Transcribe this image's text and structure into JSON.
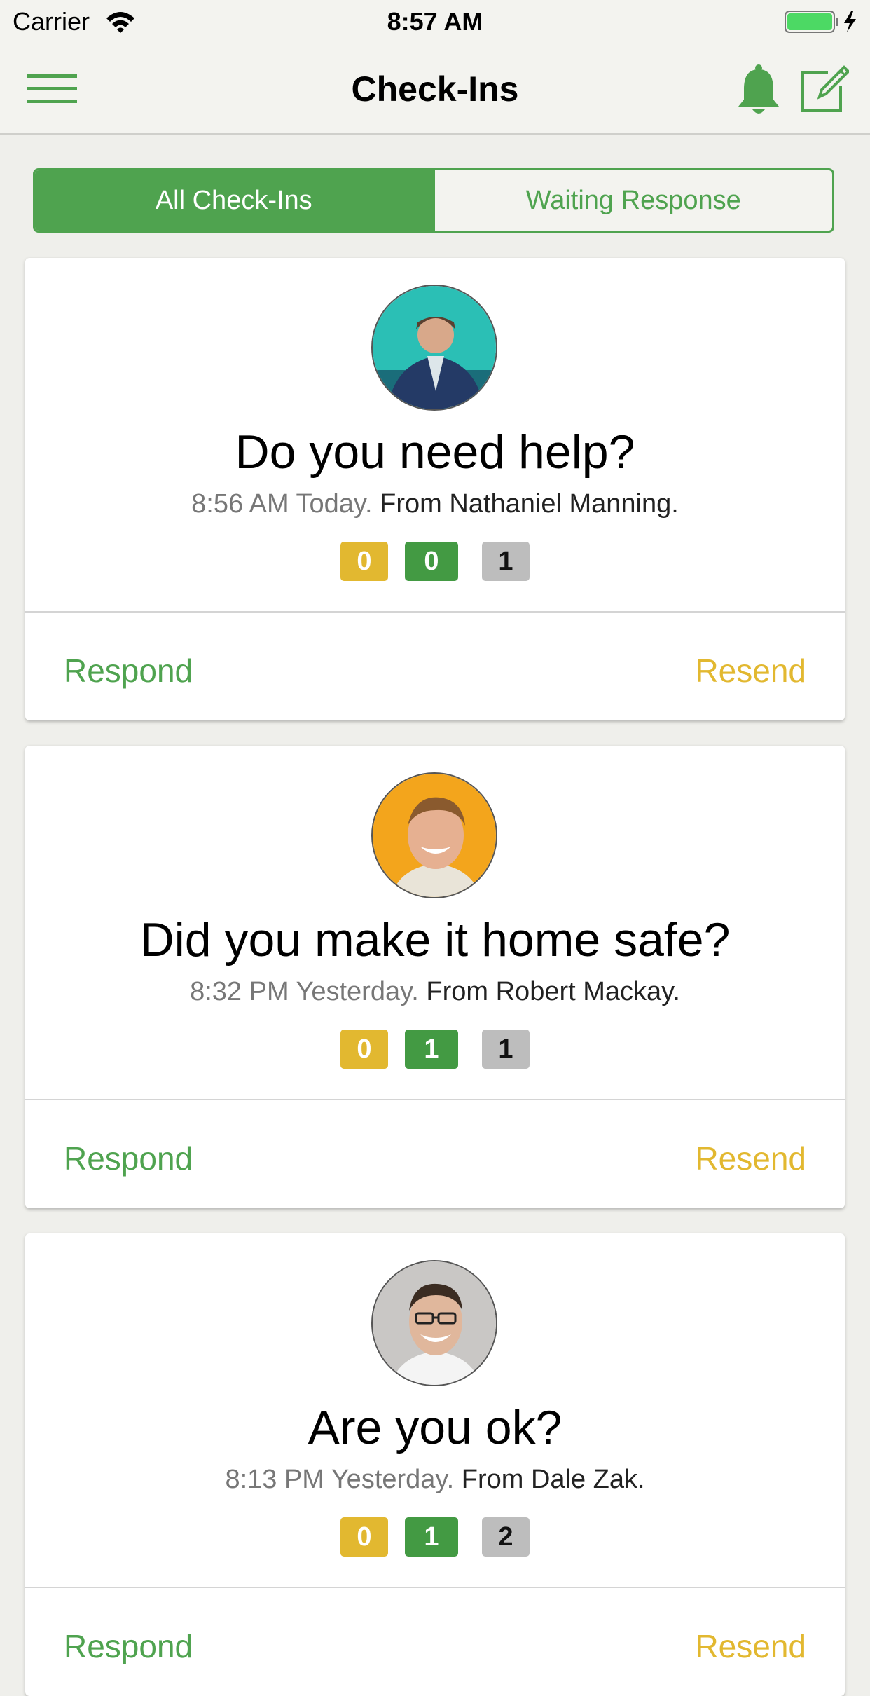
{
  "status_bar": {
    "carrier": "Carrier",
    "time": "8:57 AM"
  },
  "nav": {
    "title": "Check-Ins",
    "icons": [
      "menu-icon",
      "bell-icon",
      "compose-icon"
    ],
    "accent_color": "#4fa34f"
  },
  "tabs": [
    {
      "label": "All Check-Ins",
      "active": true
    },
    {
      "label": "Waiting Response",
      "active": false
    }
  ],
  "checkins": [
    {
      "question": "Do you need help?",
      "time": "8:56 AM Today.",
      "from": "From Nathaniel Manning.",
      "counts": [
        "0",
        "0",
        "1"
      ],
      "respond_label": "Respond",
      "resend_label": "Resend"
    },
    {
      "question": "Did you make it home safe?",
      "time": "8:32 PM Yesterday.",
      "from": "From Robert Mackay.",
      "counts": [
        "0",
        "1",
        "1"
      ],
      "respond_label": "Respond",
      "resend_label": "Resend"
    },
    {
      "question": "Are you ok?",
      "time": "8:13 PM Yesterday.",
      "from": "From Dale Zak.",
      "counts": [
        "0",
        "1",
        "2"
      ],
      "respond_label": "Respond",
      "resend_label": "Resend"
    }
  ],
  "colors": {
    "yellow": "#e2b830",
    "green": "#439a43",
    "gray": "#bdbdbd"
  }
}
